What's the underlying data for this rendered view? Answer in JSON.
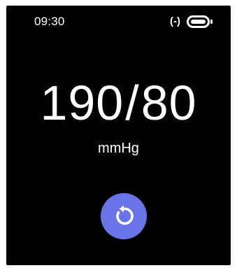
{
  "status_bar": {
    "time": "09:30",
    "bluetooth_glyph": "(-)",
    "battery_icon": "battery-full-icon"
  },
  "measurement": {
    "systolic": "190",
    "separator": "/",
    "diastolic": "80",
    "unit": "mmHg"
  },
  "actions": {
    "refresh_icon": "refresh-icon",
    "accent_color": "#6a74e9"
  }
}
